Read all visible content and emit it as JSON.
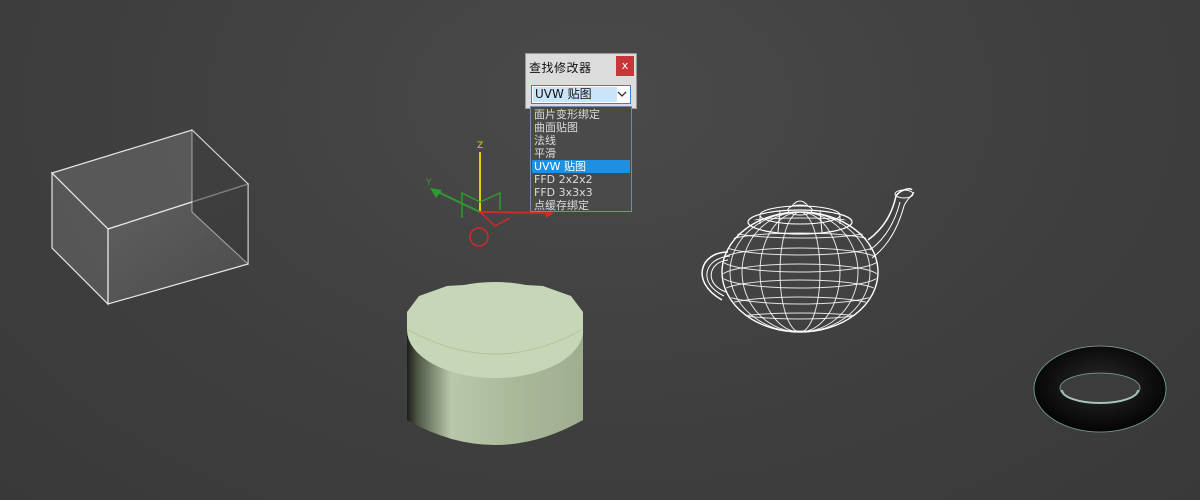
{
  "dialog": {
    "title": "查找修改器",
    "close_label": "x",
    "selected_value": "UVW 贴图"
  },
  "dropdown": {
    "items": [
      "面片变形绑定",
      "曲面贴图",
      "法线",
      "平滑",
      "UVW 贴图",
      "FFD 2x2x2",
      "FFD 3x3x3",
      "点缓存绑定"
    ],
    "selected_index": 4
  },
  "gizmo": {
    "x_label": "X",
    "y_label": "Y",
    "z_label": "Z"
  },
  "colors": {
    "viewport_bg": "#3f3f3f",
    "cylinder_top": "#c6d7b8",
    "cylinder_side": "#a9b896",
    "selection_blue": "#1e8fe1",
    "close_red": "#c8363a",
    "axis_x": "#d22a2a",
    "axis_y": "#2f9a2f",
    "axis_z": "#e6d000"
  },
  "objects": [
    "box-wireframe",
    "transform-gizmo",
    "cylinder",
    "teapot-wireframe",
    "torus"
  ]
}
